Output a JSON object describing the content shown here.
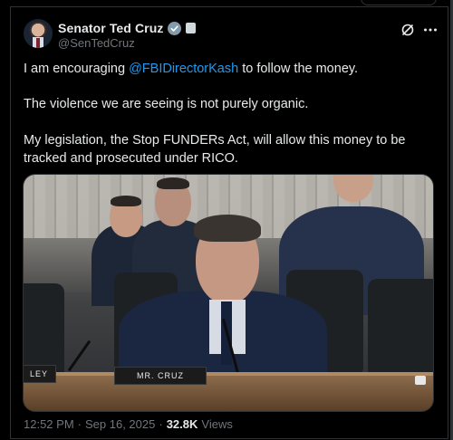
{
  "post": {
    "author_name": "Senator Ted Cruz",
    "author_handle": "@SenTedCruz",
    "text": {
      "p1_prefix": "I am encouraging ",
      "p1_mention": "@FBIDirectorKash",
      "p1_suffix": " to follow the money.",
      "p2": "The violence we are seeing is not purely organic.",
      "p3_line1": "My legislation, the Stop FUNDERs Act, will allow this money to be",
      "p3_line2": "tracked and prosecuted under RICO."
    },
    "media": {
      "nameplate_main": "MR. CRUZ",
      "nameplate_left": "LEY"
    },
    "meta": {
      "time": "12:52 PM",
      "separator1": "·",
      "date": "Sep 16, 2025",
      "separator2": "·",
      "views_count": "32.8K",
      "views_label": "Views"
    }
  },
  "icons": {
    "verified": "verified-badge-icon",
    "government": "government-badge-icon",
    "grok": "grok-icon",
    "more": "more-options-icon"
  },
  "colors": {
    "background": "#000000",
    "text_primary": "#e7e9ea",
    "text_secondary": "#71767b",
    "link": "#1d9bf0",
    "border": "#2f3336",
    "verified_badge": "#829aab"
  }
}
